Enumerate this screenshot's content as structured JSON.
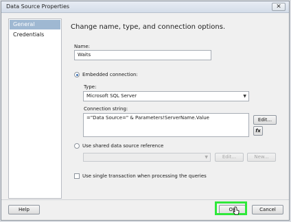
{
  "window": {
    "title": "Data Source Properties",
    "close_glyph": "✕"
  },
  "sidebar": {
    "items": [
      {
        "label": "General",
        "selected": true
      },
      {
        "label": "Credentials",
        "selected": false
      }
    ]
  },
  "main": {
    "heading": "Change name, type, and connection options.",
    "name_label": "Name:",
    "name_value": "Waits",
    "embedded_label": "Embedded connection:",
    "type_label": "Type:",
    "type_value": "Microsoft SQL Server",
    "connection_label": "Connection string:",
    "connection_value": "=\"Data Source=\" & Parameters!ServerName.Value",
    "edit_label": "Edit...",
    "fx_label": "fx",
    "shared_label": "Use shared data source reference",
    "shared_edit_label": "Edit...",
    "shared_new_label": "New...",
    "single_txn_label": "Use single transaction when processing the queries"
  },
  "footer": {
    "help_label": "Help",
    "ok_label": "OK",
    "cancel_label": "Cancel"
  },
  "colors": {
    "highlight": "#2ee83a",
    "selection": "#9fb8d2"
  }
}
